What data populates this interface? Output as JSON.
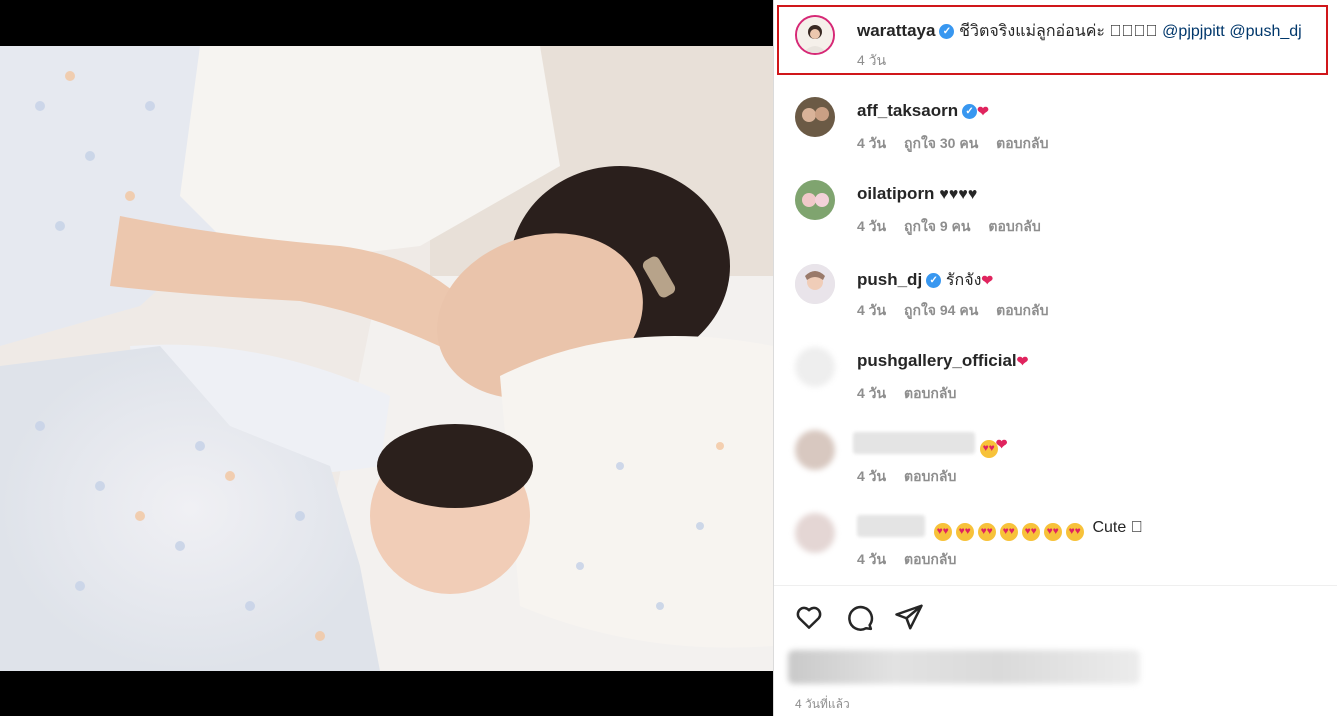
{
  "post": {
    "author": "warattaya",
    "caption": "ชีวิตจริงแม่ลูกอ่อนค่ะ 􏿾􏿾􏿾􏿾",
    "mentions": [
      "@pjpjpitt",
      "@push_dj"
    ],
    "age": "4 วัน"
  },
  "comments": [
    {
      "username": "aff_taksaorn",
      "verified": true,
      "text": "",
      "heart": true,
      "age": "4 วัน",
      "likes": "ถูกใจ 30 คน",
      "reply": "ตอบกลับ"
    },
    {
      "username": "oilatiporn",
      "verified": false,
      "text": "♥♥♥♥",
      "heart": false,
      "age": "4 วัน",
      "likes": "ถูกใจ 9 คน",
      "reply": "ตอบกลับ"
    },
    {
      "username": "push_dj",
      "verified": true,
      "text": "รักจัง",
      "heart": true,
      "age": "4 วัน",
      "likes": "ถูกใจ 94 คน",
      "reply": "ตอบกลับ"
    },
    {
      "username": "pushgallery_official",
      "verified": false,
      "text": "",
      "heart": true,
      "age": "4 วัน",
      "likes": "",
      "reply": "ตอบกลับ"
    },
    {
      "username": "",
      "verified": false,
      "text": "",
      "heart": true,
      "age": "4 วัน",
      "likes": "",
      "reply": "ตอบกลับ"
    },
    {
      "username": "",
      "verified": false,
      "text": "Cute 􏿾",
      "heart": false,
      "age": "4 วัน",
      "likes": "",
      "reply": "ตอบกลับ"
    }
  ],
  "footer": {
    "timestamp": "4 วันที่แล้ว"
  },
  "colors": {
    "highlight_border": "#d0161a",
    "verified": "#3897f0",
    "link": "#00376b",
    "meta": "#8e8e8e"
  },
  "icons": [
    "heart-outline-icon",
    "comment-icon",
    "share-icon",
    "verified-badge-icon",
    "heart-emoji-icon",
    "heart-eyes-emoji-icon"
  ]
}
